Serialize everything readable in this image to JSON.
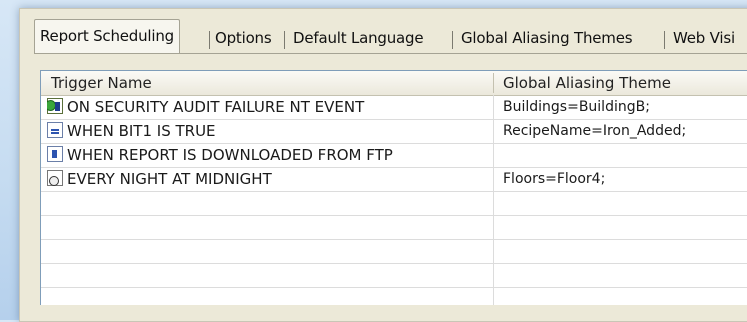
{
  "tabs": [
    {
      "label": "Report Scheduling",
      "active": true
    },
    {
      "label": "Options",
      "active": false
    },
    {
      "label": "Default Language",
      "active": false
    },
    {
      "label": "Global Aliasing Themes",
      "active": false
    },
    {
      "label": "Web Visi",
      "active": false
    }
  ],
  "grid": {
    "columns": [
      "Trigger Name",
      "Global Aliasing Theme"
    ],
    "rows": [
      {
        "icon": "security-audit-icon",
        "trigger": "ON SECURITY AUDIT FAILURE NT EVENT",
        "theme": "Buildings=BuildingB;"
      },
      {
        "icon": "bit-trigger-icon",
        "trigger": "WHEN BIT1 IS TRUE",
        "theme": "RecipeName=Iron_Added;"
      },
      {
        "icon": "ftp-download-icon",
        "trigger": "WHEN REPORT IS DOWNLOADED FROM FTP",
        "theme": ""
      },
      {
        "icon": "clock-schedule-icon",
        "trigger": "EVERY NIGHT AT MIDNIGHT",
        "theme": "Floors=Floor4;"
      }
    ]
  }
}
